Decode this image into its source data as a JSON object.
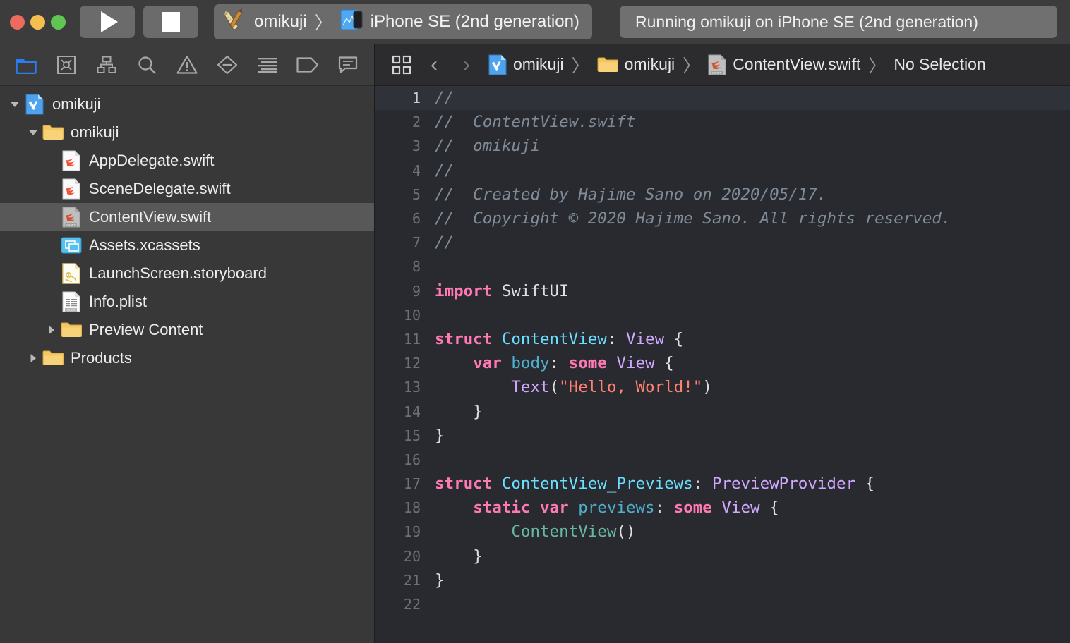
{
  "titlebar": {
    "traffic_lights": [
      "close",
      "minimize",
      "zoom"
    ],
    "run_button_label": "Run",
    "stop_button_label": "Stop",
    "scheme": {
      "project_name": "omikuji",
      "separator": "〉",
      "destination": "iPhone SE (2nd generation)"
    },
    "status": "Running omikuji on iPhone SE (2nd generation)"
  },
  "navigator": {
    "toolbar_icons": [
      {
        "name": "project-navigator-icon",
        "label": "Project navigator",
        "active": true
      },
      {
        "name": "source-control-navigator-icon",
        "label": "Source Control navigator",
        "active": false
      },
      {
        "name": "symbol-navigator-icon",
        "label": "Symbol navigator",
        "active": false
      },
      {
        "name": "find-navigator-icon",
        "label": "Find navigator",
        "active": false
      },
      {
        "name": "issue-navigator-icon",
        "label": "Issue navigator",
        "active": false
      },
      {
        "name": "test-navigator-icon",
        "label": "Test navigator",
        "active": false
      },
      {
        "name": "report-navigator-icon",
        "label": "Report navigator",
        "active": false
      },
      {
        "name": "breakpoint-navigator-icon",
        "label": "Breakpoint navigator",
        "active": false
      },
      {
        "name": "debug-navigator-icon",
        "label": "Debug navigator",
        "active": false
      }
    ],
    "tree": [
      {
        "label": "omikuji",
        "icon": "xcode-project-icon",
        "indent": 0,
        "disclosure": "open",
        "selected": false
      },
      {
        "label": "omikuji",
        "icon": "folder-icon",
        "indent": 1,
        "disclosure": "open",
        "selected": false
      },
      {
        "label": "AppDelegate.swift",
        "icon": "swift-file-icon",
        "indent": 2,
        "disclosure": "none",
        "selected": false
      },
      {
        "label": "SceneDelegate.swift",
        "icon": "swift-file-icon",
        "indent": 2,
        "disclosure": "none",
        "selected": false
      },
      {
        "label": "ContentView.swift",
        "icon": "swift-file-icon-gray",
        "indent": 2,
        "disclosure": "none",
        "selected": true
      },
      {
        "label": "Assets.xcassets",
        "icon": "assets-icon",
        "indent": 2,
        "disclosure": "none",
        "selected": false
      },
      {
        "label": "LaunchScreen.storyboard",
        "icon": "storyboard-icon",
        "indent": 2,
        "disclosure": "none",
        "selected": false
      },
      {
        "label": "Info.plist",
        "icon": "plist-icon",
        "indent": 2,
        "disclosure": "none",
        "selected": false
      },
      {
        "label": "Preview Content",
        "icon": "folder-icon",
        "indent": 2,
        "disclosure": "closed",
        "selected": false
      },
      {
        "label": "Products",
        "icon": "folder-icon",
        "indent": 1,
        "disclosure": "closed",
        "selected": false
      }
    ]
  },
  "editor": {
    "jumpbar": {
      "related_items_label": "Related Items",
      "back_label": "‹",
      "forward_label": "›",
      "breadcrumb": [
        {
          "label": "omikuji",
          "icon": "xcode-project-icon"
        },
        {
          "label": "omikuji",
          "icon": "folder-icon"
        },
        {
          "label": "ContentView.swift",
          "icon": "swift-file-icon-gray"
        },
        {
          "label": "No Selection",
          "icon": "none"
        }
      ],
      "separator": "〉"
    },
    "filename": "ContentView.swift",
    "current_line": 1,
    "total_lines": 22,
    "code_lines": [
      {
        "n": 1,
        "tokens": [
          {
            "t": "//",
            "c": "comment"
          }
        ]
      },
      {
        "n": 2,
        "tokens": [
          {
            "t": "//  ContentView.swift",
            "c": "comment"
          }
        ]
      },
      {
        "n": 3,
        "tokens": [
          {
            "t": "//  omikuji",
            "c": "comment"
          }
        ]
      },
      {
        "n": 4,
        "tokens": [
          {
            "t": "//",
            "c": "comment"
          }
        ]
      },
      {
        "n": 5,
        "tokens": [
          {
            "t": "//  Created by Hajime Sano on 2020/05/17.",
            "c": "comment"
          }
        ]
      },
      {
        "n": 6,
        "tokens": [
          {
            "t": "//  Copyright © 2020 Hajime Sano. All rights reserved.",
            "c": "comment"
          }
        ]
      },
      {
        "n": 7,
        "tokens": [
          {
            "t": "//",
            "c": "comment"
          }
        ]
      },
      {
        "n": 8,
        "tokens": []
      },
      {
        "n": 9,
        "tokens": [
          {
            "t": "import",
            "c": "keyword"
          },
          {
            "t": " ",
            "c": "plain"
          },
          {
            "t": "SwiftUI",
            "c": "plain"
          }
        ]
      },
      {
        "n": 10,
        "tokens": []
      },
      {
        "n": 11,
        "tokens": [
          {
            "t": "struct",
            "c": "keyword"
          },
          {
            "t": " ",
            "c": "plain"
          },
          {
            "t": "ContentView",
            "c": "typedecl"
          },
          {
            "t": ": ",
            "c": "plain"
          },
          {
            "t": "View",
            "c": "type"
          },
          {
            "t": " {",
            "c": "plain"
          }
        ]
      },
      {
        "n": 12,
        "tokens": [
          {
            "t": "    ",
            "c": "plain"
          },
          {
            "t": "var",
            "c": "keyword"
          },
          {
            "t": " ",
            "c": "plain"
          },
          {
            "t": "body",
            "c": "prop"
          },
          {
            "t": ": ",
            "c": "plain"
          },
          {
            "t": "some",
            "c": "keyword"
          },
          {
            "t": " ",
            "c": "plain"
          },
          {
            "t": "View",
            "c": "type"
          },
          {
            "t": " {",
            "c": "plain"
          }
        ]
      },
      {
        "n": 13,
        "tokens": [
          {
            "t": "        ",
            "c": "plain"
          },
          {
            "t": "Text",
            "c": "type"
          },
          {
            "t": "(",
            "c": "plain"
          },
          {
            "t": "\"Hello, World!\"",
            "c": "string"
          },
          {
            "t": ")",
            "c": "plain"
          }
        ]
      },
      {
        "n": 14,
        "tokens": [
          {
            "t": "    }",
            "c": "plain"
          }
        ]
      },
      {
        "n": 15,
        "tokens": [
          {
            "t": "}",
            "c": "plain"
          }
        ]
      },
      {
        "n": 16,
        "tokens": []
      },
      {
        "n": 17,
        "tokens": [
          {
            "t": "struct",
            "c": "keyword"
          },
          {
            "t": " ",
            "c": "plain"
          },
          {
            "t": "ContentView_Previews",
            "c": "typedecl"
          },
          {
            "t": ": ",
            "c": "plain"
          },
          {
            "t": "PreviewProvider",
            "c": "type"
          },
          {
            "t": " {",
            "c": "plain"
          }
        ]
      },
      {
        "n": 18,
        "tokens": [
          {
            "t": "    ",
            "c": "plain"
          },
          {
            "t": "static",
            "c": "keyword"
          },
          {
            "t": " ",
            "c": "plain"
          },
          {
            "t": "var",
            "c": "keyword"
          },
          {
            "t": " ",
            "c": "plain"
          },
          {
            "t": "previews",
            "c": "prop"
          },
          {
            "t": ": ",
            "c": "plain"
          },
          {
            "t": "some",
            "c": "keyword"
          },
          {
            "t": " ",
            "c": "plain"
          },
          {
            "t": "View",
            "c": "type"
          },
          {
            "t": " {",
            "c": "plain"
          }
        ]
      },
      {
        "n": 19,
        "tokens": [
          {
            "t": "        ",
            "c": "plain"
          },
          {
            "t": "ContentView",
            "c": "func"
          },
          {
            "t": "()",
            "c": "plain"
          }
        ]
      },
      {
        "n": 20,
        "tokens": [
          {
            "t": "    }",
            "c": "plain"
          }
        ]
      },
      {
        "n": 21,
        "tokens": [
          {
            "t": "}",
            "c": "plain"
          }
        ]
      },
      {
        "n": 22,
        "tokens": []
      }
    ]
  },
  "colors": {
    "titlebar_bg": "#3C3C3C",
    "navigator_bg": "#383838",
    "editor_bg": "#292A30",
    "current_line_bg": "#2F3239",
    "selection_bg": "#585858",
    "accent_blue": "#2B7DF5",
    "keyword": "#FF7AB2",
    "type": "#D0A8FF",
    "type_decl": "#6BDFFF",
    "string": "#FF8170",
    "comment": "#7F8C98",
    "property": "#4EB0CC",
    "function": "#67B7A4",
    "plain_text": "#DFDFE0"
  }
}
